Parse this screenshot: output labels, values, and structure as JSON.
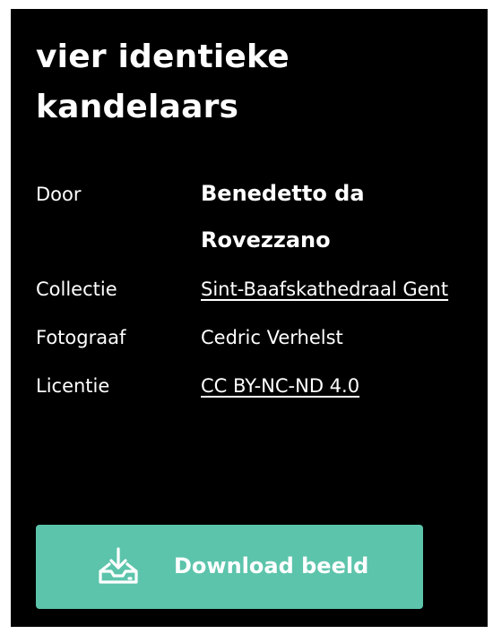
{
  "title": {
    "line1": "vier identieke",
    "line2": "kandelaars"
  },
  "meta": {
    "door_label": "Door",
    "door_value_line1": "Benedetto da",
    "door_value_line2": "Rovezzano",
    "collectie_label": "Collectie",
    "collectie_value": "Sint-Baafskathedraal Gent",
    "fotograaf_label": "Fotograaf",
    "fotograaf_value": "Cedric Verhelst",
    "licentie_label": "Licentie",
    "licentie_value": "CC BY-NC-ND 4.0"
  },
  "download": {
    "label": "Download beeld",
    "icon": "download-tray-icon"
  },
  "colors": {
    "background": "#000000",
    "text": "#ffffff",
    "button": "#5cc4ab"
  }
}
